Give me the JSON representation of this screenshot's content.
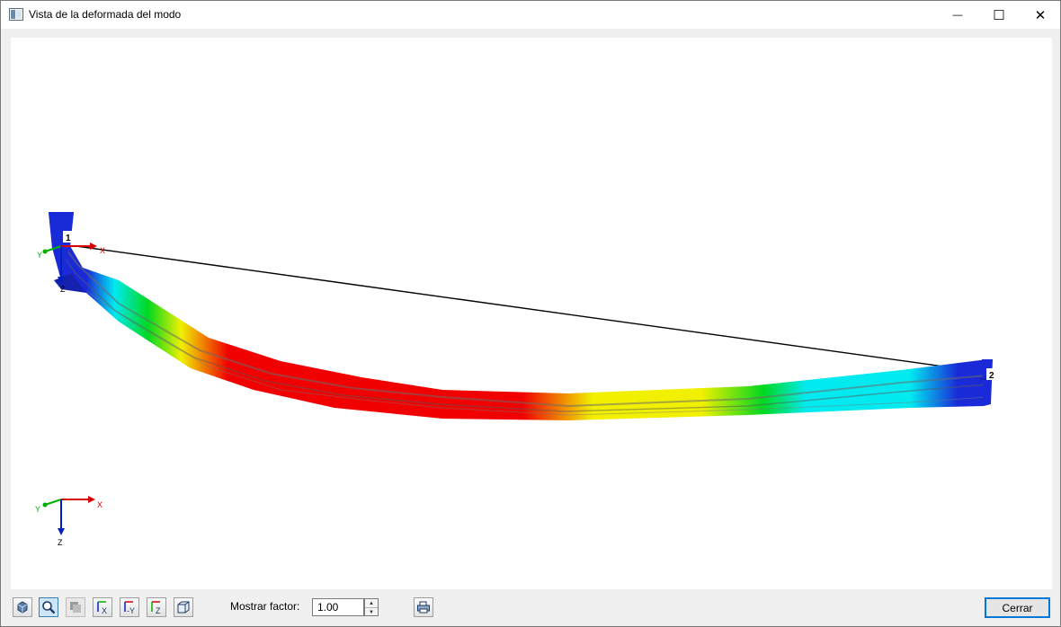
{
  "window": {
    "title": "Vista de la deformada del modo",
    "minimize_glyph": "—",
    "maximize_glyph": "☐",
    "close_glyph": "✕"
  },
  "model": {
    "node_1_label": "1",
    "node_2_label": "2",
    "local_axes": {
      "x": "X",
      "y": "Y",
      "z": "Z"
    }
  },
  "triad": {
    "x": "X",
    "y": "Y",
    "z": "Z"
  },
  "colors": {
    "min": "#1a2ad8",
    "low": "#00eaf0",
    "mid": "#00d820",
    "high": "#f0f000",
    "max": "#f00000",
    "axis_x": "#d60000",
    "axis_y": "#00b000",
    "axis_z": "#0020c0",
    "accent": "#0078d7"
  },
  "toolbar": {
    "buttons": [
      {
        "name": "3d-view-icon",
        "state": "normal"
      },
      {
        "name": "zoom-icon",
        "state": "active"
      },
      {
        "name": "render-mode-icon",
        "state": "disabled"
      },
      {
        "name": "view-x-icon",
        "state": "normal",
        "caption": "X"
      },
      {
        "name": "view-minus-y-icon",
        "state": "normal",
        "caption": "-Y"
      },
      {
        "name": "view-z-icon",
        "state": "normal",
        "caption": "Z"
      },
      {
        "name": "isometric-box-icon",
        "state": "normal"
      }
    ],
    "factor_label": "Mostrar factor:",
    "factor_value": "1.00",
    "close_label": "Cerrar"
  }
}
